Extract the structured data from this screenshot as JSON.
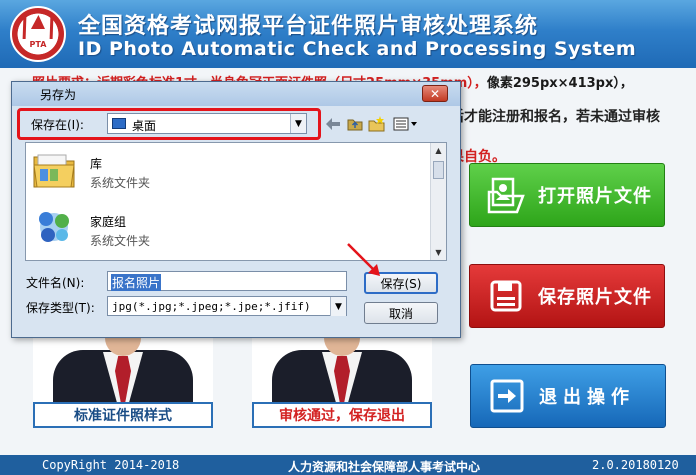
{
  "app": {
    "title_cn": "全国资格考试网报平台证件照片审核处理系统",
    "title_en": "ID Photo Automatic Check and Processing System",
    "logo_text": "PTA"
  },
  "content": {
    "req_prefix": "照片要求：近期彩色标准1寸，半身免冠正面证件照（尺寸25mm×35mm），",
    "req_pixels": "像素295px×413px），",
    "notice_text": "后才能注册和报名，若未通过审核",
    "notice_red": "果自负。"
  },
  "buttons": {
    "open": "打开照片文件",
    "save": "保存照片文件",
    "exit": "退出操作"
  },
  "captions": {
    "standard": "标准证件照样式",
    "passed": "审核通过，保存退出"
  },
  "footer": {
    "copyright": "CopyRight 2014-2018",
    "org": "人力资源和社会保障部人事考试中心",
    "version": "2.0.20180120"
  },
  "dialog": {
    "title": "另存为",
    "lookin_label": "保存在(I):",
    "lookin_value": "桌面",
    "files": [
      {
        "name": "库",
        "type": "系统文件夹",
        "icon": "library-folder-icon"
      },
      {
        "name": "家庭组",
        "type": "系统文件夹",
        "icon": "homegroup-icon"
      }
    ],
    "filename_label": "文件名(N):",
    "filename_value": "报名照片",
    "filetype_label": "保存类型(T):",
    "filetype_value": "jpg(*.jpg;*.jpeg;*.jpe;*.jfif)",
    "save_button": "保存(S)",
    "cancel_button": "取消",
    "close_glyph": "✕"
  },
  "colors": {
    "highlight_frame": "#e4141b",
    "open_button": "#2ea51a",
    "save_button": "#b31414",
    "exit_button": "#1668b8"
  }
}
